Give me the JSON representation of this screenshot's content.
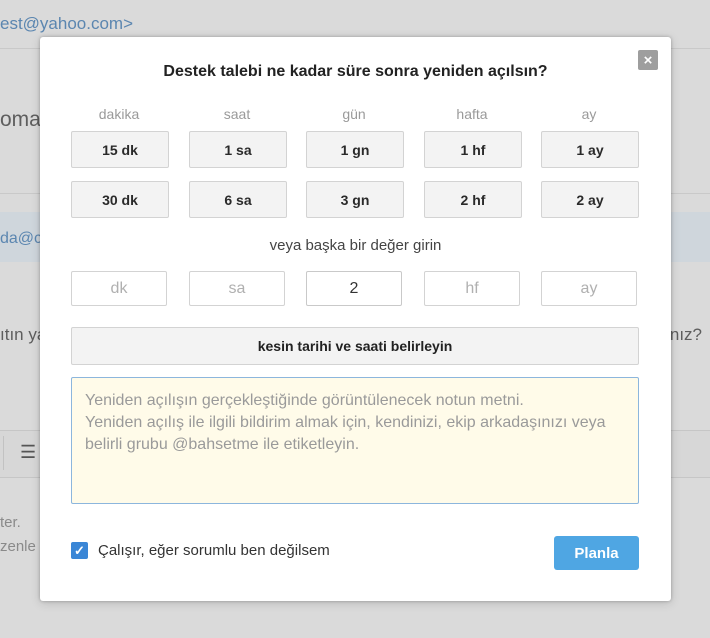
{
  "background": {
    "email_top": "est@yahoo.com>",
    "text_1": "oma i",
    "email_2": "da@c",
    "text_3_left": "ıtın ya",
    "text_3_right": "nız?",
    "list_icon": "☰",
    "text_4": "ter.",
    "text_5": "zenle"
  },
  "modal": {
    "title": "Destek talebi ne kadar süre sonra yeniden açılsın?",
    "close_icon": "×",
    "columns": [
      {
        "header": "dakika",
        "options": [
          "15 dk",
          "30 dk"
        ],
        "input_placeholder": "dk",
        "input_value": ""
      },
      {
        "header": "saat",
        "options": [
          "1 sa",
          "6 sa"
        ],
        "input_placeholder": "sa",
        "input_value": ""
      },
      {
        "header": "gün",
        "options": [
          "1 gn",
          "3 gn"
        ],
        "input_placeholder": "",
        "input_value": "2"
      },
      {
        "header": "hafta",
        "options": [
          "1 hf",
          "2 hf"
        ],
        "input_placeholder": "hf",
        "input_value": ""
      },
      {
        "header": "ay",
        "options": [
          "1 ay",
          "2 ay"
        ],
        "input_placeholder": "ay",
        "input_value": ""
      }
    ],
    "or_label": "veya başka bir değer girin",
    "exact_button": "kesin tarihi ve saati belirleyin",
    "note_placeholder": "Yeniden açılışın gerçekleştiğinde görüntülenecek notun metni.\nYeniden açılış ile ilgili bildirim almak için, kendinizi, ekip arkadaşınızı veya belirli grubu @bahsetme ile etiketleyin.",
    "checkbox_label": "Çalışır, eğer sorumlu ben değilsem",
    "checkbox_checked": true,
    "plan_button": "Planla",
    "colors": {
      "accent": "#4fa6e3",
      "checkbox": "#3a86d6",
      "note_bg": "#fffbe9"
    }
  }
}
